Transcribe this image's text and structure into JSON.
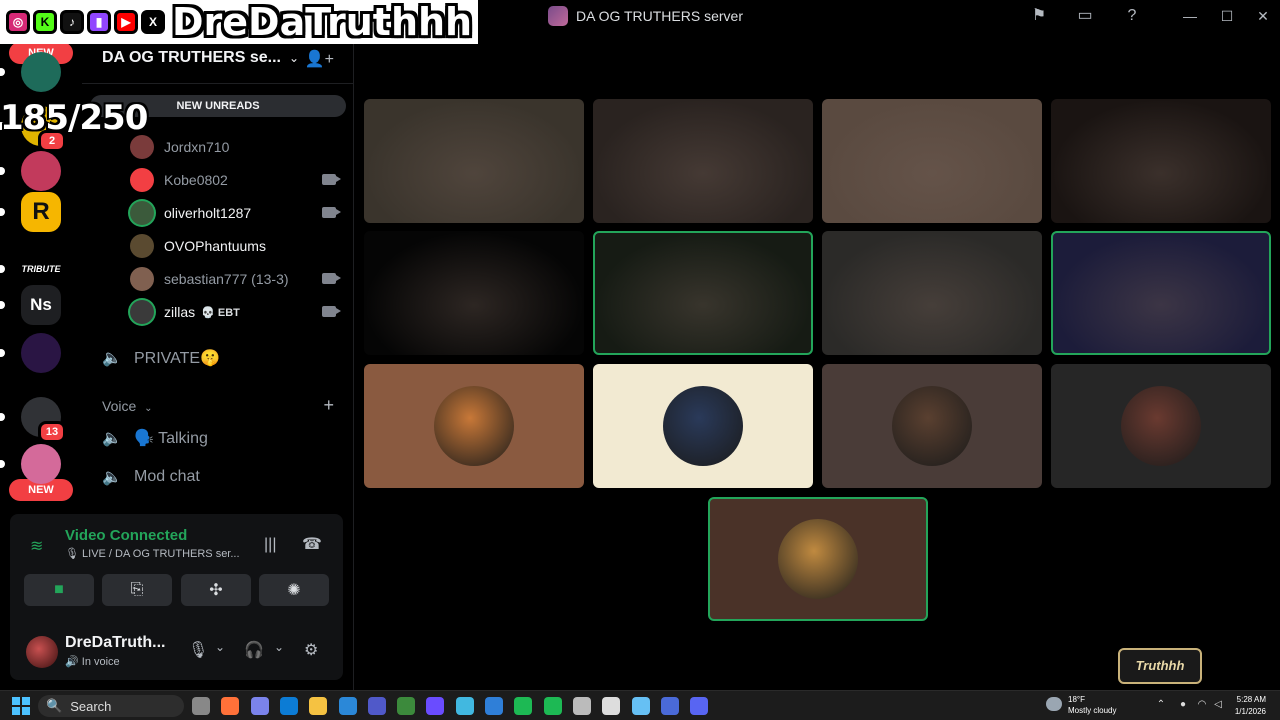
{
  "overlay": {
    "streamer_name": "DreDaTruthhh",
    "socials": [
      {
        "name": "instagram-icon",
        "glyph": "◎",
        "color": "#d62976"
      },
      {
        "name": "kick-icon",
        "glyph": "K",
        "color": "#53fc18"
      },
      {
        "name": "tiktok-icon",
        "glyph": "♪",
        "color": "#111111"
      },
      {
        "name": "twitch-icon",
        "glyph": "▮",
        "color": "#9146ff"
      },
      {
        "name": "youtube-icon",
        "glyph": "▶",
        "color": "#ff0000"
      },
      {
        "name": "x-icon",
        "glyph": "X",
        "color": "#000000"
      }
    ],
    "counter": "185/250",
    "watermark": "Truthhh"
  },
  "titlebar": {
    "server_title": "DA OG TRUTHERS server",
    "icons": [
      "flag-icon",
      "inbox-icon",
      "help-icon"
    ],
    "window_controls": [
      "minimize",
      "maximize",
      "close"
    ]
  },
  "guilds": {
    "new_top": "NEW",
    "new_bottom": "NEW",
    "items": [
      {
        "name": "guild-party",
        "label": "",
        "color": "#1e6b5a",
        "badge": ""
      },
      {
        "name": "guild-yellow",
        "label": "",
        "color": "#e0b400",
        "badge": "2"
      },
      {
        "name": "guild-pink-face",
        "label": "",
        "color": "#c23a5c",
        "badge": ""
      },
      {
        "name": "guild-rockstar",
        "label": "R",
        "color": "#f6b600",
        "badge": ""
      },
      {
        "name": "guild-tribute",
        "label": "TRIBUTE",
        "color": "#000000",
        "badge": ""
      },
      {
        "name": "guild-ns",
        "label": "Ns",
        "color": "#1e1f22",
        "badge": ""
      },
      {
        "name": "guild-purple-face",
        "label": "",
        "color": "#2a1544",
        "badge": ""
      },
      {
        "name": "guild-dark",
        "label": "",
        "color": "#303236",
        "badge": "13"
      },
      {
        "name": "guild-pink",
        "label": "",
        "color": "#d46a9a",
        "badge": ""
      }
    ]
  },
  "sidebar": {
    "server_name": "DA OG TRUTHERS se...",
    "new_unreads": "NEW UNREADS",
    "voice_users": [
      {
        "name": "Jordxn710",
        "bright": false,
        "camera": false,
        "tag": "",
        "color": "#7a3b3b"
      },
      {
        "name": "Kobe0802",
        "bright": false,
        "camera": true,
        "tag": "",
        "color": "#f23f43"
      },
      {
        "name": "oliverholt1287",
        "bright": true,
        "camera": true,
        "tag": "",
        "color": "#3b5a3b"
      },
      {
        "name": "OVOPhantuums",
        "bright": true,
        "camera": false,
        "tag": "",
        "color": "#5a4a30"
      },
      {
        "name": "sebastian777 (13-3)",
        "bright": false,
        "camera": true,
        "tag": "",
        "color": "#806050"
      },
      {
        "name": "zillas",
        "bright": true,
        "camera": true,
        "tag": "💀 EBT",
        "color": "#3a3a3a"
      }
    ],
    "channels": [
      {
        "name": "PRIVATE🤫",
        "icon": "speaker-lock-icon"
      }
    ],
    "voice_category": "Voice",
    "voice_channels": [
      {
        "name": "🗣️ Talking",
        "icon": "speaker-icon"
      },
      {
        "name": "Mod chat",
        "icon": "speaker-lock-icon"
      }
    ]
  },
  "voice_panel": {
    "status": "Video Connected",
    "channel": "LIVE / DA OG TRUTHERS ser...",
    "user_name": "DreDaTruth...",
    "user_status": "In voice"
  },
  "tiles": [
    {
      "name": "tile-1",
      "bg": "#3a342c",
      "speaking": false
    },
    {
      "name": "tile-2",
      "bg": "#2a2320",
      "speaking": false
    },
    {
      "name": "tile-3",
      "bg": "#5a4a40",
      "speaking": false
    },
    {
      "name": "tile-4",
      "bg": "#1a1412",
      "speaking": false
    },
    {
      "name": "tile-5",
      "bg": "#050505",
      "speaking": false
    },
    {
      "name": "tile-6",
      "bg": "#161b14",
      "speaking": true
    },
    {
      "name": "tile-7",
      "bg": "#2b2a28",
      "speaking": false
    },
    {
      "name": "tile-8",
      "bg": "#1c1c3a",
      "speaking": true
    },
    {
      "name": "tile-9",
      "bg": "#8a5a40",
      "speaking": false,
      "avatar": "#c87838"
    },
    {
      "name": "tile-10",
      "bg": "#f2ead2",
      "speaking": false,
      "avatar": "#2a3a5a"
    },
    {
      "name": "tile-11",
      "bg": "#4a3c38",
      "speaking": false,
      "avatar": "#5a4030"
    },
    {
      "name": "tile-12",
      "bg": "#262626",
      "speaking": false,
      "avatar": "#6a3a30"
    },
    {
      "name": "tile-13",
      "bg": "#4a3228",
      "speaking": true,
      "avatar": "#c08a40"
    }
  ],
  "taskbar": {
    "search": "Search",
    "weather_temp": "18°F",
    "weather_desc": "Mostly cloudy",
    "time": "5:28 AM",
    "date": "1/1/2026",
    "apps": [
      "#888888",
      "#ff7139",
      "#7b83eb",
      "#0c7cd5",
      "#f5c242",
      "#2b88d8",
      "#5059c9",
      "#3c8a3c",
      "#6a4cff",
      "#41b8e0",
      "#2f7fd8",
      "#1db954",
      "#1db954",
      "#bbbbbb",
      "#dddddd",
      "#66c0f4",
      "#4a6ad8",
      "#5865f2"
    ]
  }
}
